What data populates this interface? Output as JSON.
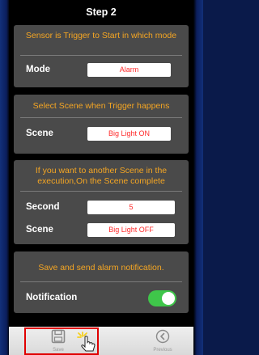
{
  "header": {
    "title": "Step 2"
  },
  "trigger_mode": {
    "heading": "Sensor is Trigger to Start in which mode",
    "mode_label": "Mode",
    "mode_value": "Alarm"
  },
  "scene_trigger": {
    "heading": "Select Scene when Trigger happens",
    "scene_label": "Scene",
    "scene_value": "Big Light ON"
  },
  "scene_complete": {
    "heading": "If you want to another Scene in the execution,On the Scene complete",
    "second_label": "Second",
    "second_value": "5",
    "scene_label": "Scene",
    "scene_value": "Big Light OFF"
  },
  "notification": {
    "heading": "Save and send alarm notification.",
    "label": "Notification",
    "enabled": true
  },
  "bottom_bar": {
    "save_label": "Save",
    "previous_label": "Previous"
  },
  "colors": {
    "accent": "#f5a623",
    "value_text": "#ff2a2a",
    "toggle_on": "#3fc64a",
    "highlight": "#e00000"
  }
}
